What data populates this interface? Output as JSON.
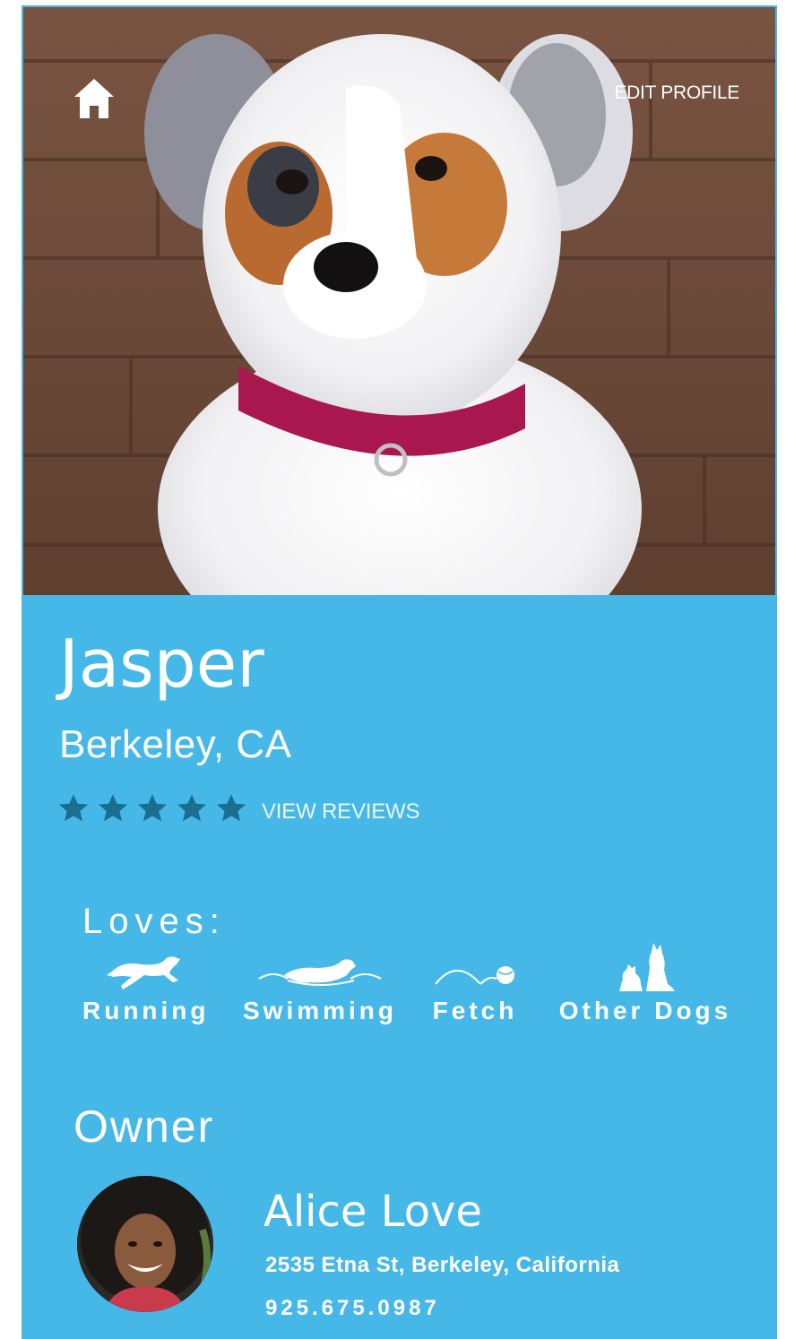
{
  "header": {
    "edit_label": "EDIT PROFILE",
    "home_icon": "home-icon"
  },
  "dog": {
    "name": "Jasper",
    "location": "Berkeley, CA",
    "rating": 5,
    "rating_max": 5,
    "reviews_label": "VIEW REVIEWS"
  },
  "loves": {
    "title": "Loves:",
    "items": [
      {
        "label": "Running",
        "icon": "running-dog-icon"
      },
      {
        "label": "Swimming",
        "icon": "swimming-dog-icon"
      },
      {
        "label": "Fetch",
        "icon": "fetch-ball-icon"
      },
      {
        "label": "Other Dogs",
        "icon": "dog-and-cat-icon"
      }
    ]
  },
  "owner": {
    "title": "Owner",
    "name": "Alice Love",
    "address": "2535 Etna St, Berkeley, California",
    "phone": "925.675.0987"
  },
  "colors": {
    "card": "#46b8e8",
    "star": "#1a6e8e",
    "text": "#ffffff"
  }
}
